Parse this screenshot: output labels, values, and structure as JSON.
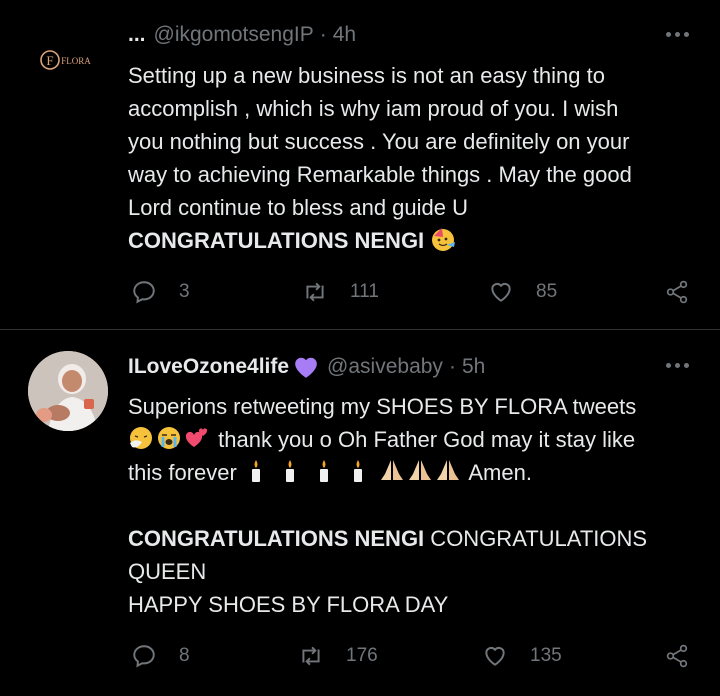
{
  "tweet1": {
    "dots": "...",
    "handle": "@ikgomotsengIP",
    "sep": "·",
    "time": "4h",
    "avatar_text": "FLORA",
    "body_lines": [
      "Setting up a new business is not an easy thing to",
      "accomplish , which is why iam proud of you. I wish",
      "you nothing but success . You are definitely on your",
      "way to achieving Remarkable things . May the good",
      "Lord continue to bless and guide U"
    ],
    "body_bold": "CONGRATULATIONS NENGI",
    "replies": "3",
    "retweets": "111",
    "likes": "85"
  },
  "tweet2": {
    "name": "ILoveOzone4life",
    "handle": "@asivebaby",
    "sep": "·",
    "time": "5h",
    "line1": "Superions retweeting my SHOES BY FLORA tweets",
    "line2": "thank you o Oh Father God may it stay like",
    "line3a": "this forever",
    "line3b": "Amen.",
    "line5a": "CONGRATULATIONS NENGI",
    "line5b": " CONGRATULATIONS",
    "line6": "QUEEN",
    "line7": "HAPPY SHOES BY FLORA DAY",
    "replies": "8",
    "retweets": "176",
    "likes": "135"
  },
  "colors": {
    "background": "#000000",
    "text": "#e7e9ea",
    "muted": "#71767b",
    "divider": "#2f3336",
    "verified_heart": "#a67df5"
  },
  "icons": [
    "more-icon",
    "reply-icon",
    "retweet-icon",
    "like-icon",
    "share-icon",
    "purple-heart-icon",
    "party-face-emoji",
    "sneezing-face-emoji",
    "crying-face-emoji",
    "two-hearts-emoji",
    "candle-emoji",
    "praying-hands-emoji"
  ]
}
